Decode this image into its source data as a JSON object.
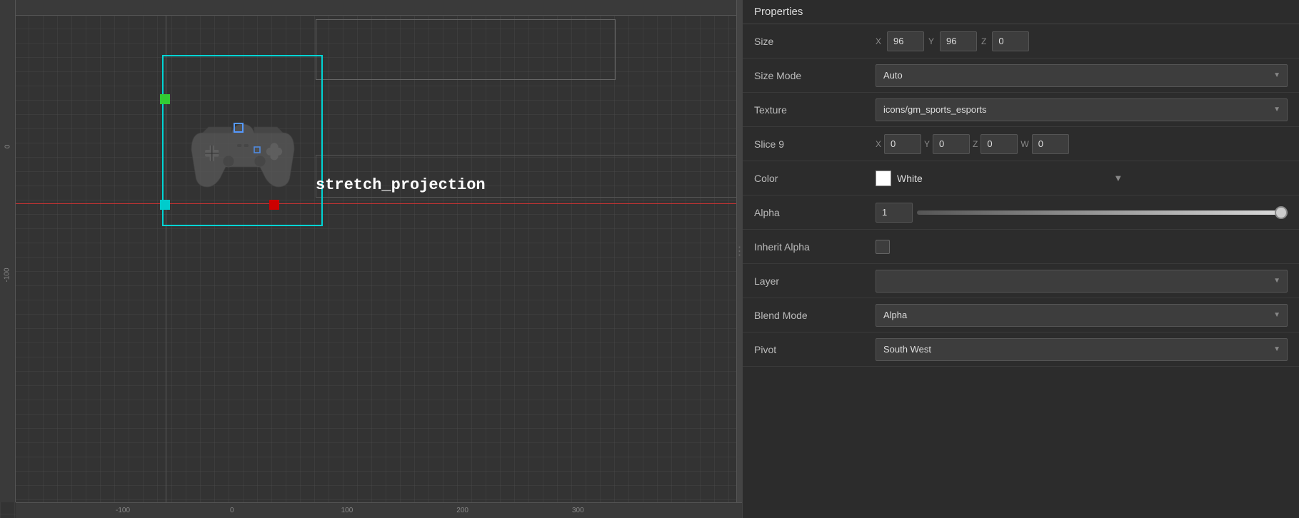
{
  "panel": {
    "title": "Properties",
    "properties": {
      "size": {
        "label": "Size",
        "x_label": "X",
        "x_val": "96",
        "y_label": "Y",
        "y_val": "96",
        "z_label": "Z",
        "z_val": "0"
      },
      "size_mode": {
        "label": "Size Mode",
        "value": "Auto"
      },
      "texture": {
        "label": "Texture",
        "value": "icons/gm_sports_esports"
      },
      "slice9": {
        "label": "Slice 9",
        "x_label": "X",
        "x_val": "0",
        "y_label": "Y",
        "y_val": "0",
        "z_label": "Z",
        "z_val": "0",
        "w_label": "W",
        "w_val": "0"
      },
      "color": {
        "label": "Color",
        "swatch": "#ffffff",
        "value": "White"
      },
      "alpha": {
        "label": "Alpha",
        "value": "1"
      },
      "inherit_alpha": {
        "label": "Inherit Alpha"
      },
      "layer": {
        "label": "Layer",
        "value": ""
      },
      "blend_mode": {
        "label": "Blend Mode",
        "value": "Alpha"
      },
      "pivot": {
        "label": "Pivot",
        "value": "South West"
      }
    }
  },
  "canvas": {
    "stretch_text": "stretch_projection",
    "ruler_ticks": [
      "-100",
      "0",
      "100",
      "200",
      "300"
    ]
  }
}
